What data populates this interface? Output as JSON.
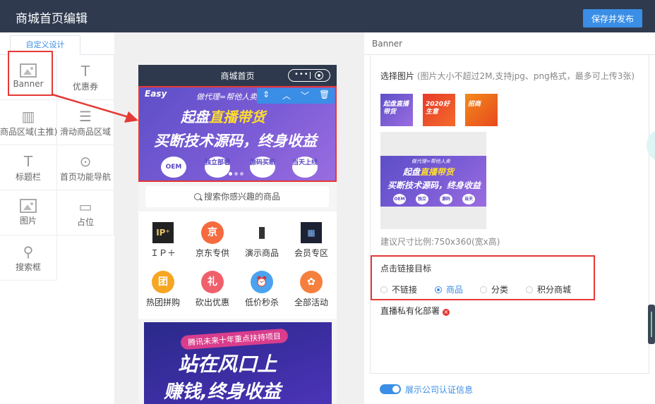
{
  "header": {
    "title": "商城首页编辑",
    "publish_label": "保存并发布"
  },
  "left_panel": {
    "tab_label": "自定义设计",
    "widgets": [
      {
        "label": "Banner",
        "icon": "image-icon"
      },
      {
        "label": "优惠券",
        "icon": "text-t-icon"
      },
      {
        "label": "商品区域(主推)",
        "icon": "building-icon"
      },
      {
        "label": "滑动商品区域",
        "icon": "list-icon"
      },
      {
        "label": "标题栏",
        "icon": "text-t-icon"
      },
      {
        "label": "首页功能导航",
        "icon": "location-pin-icon"
      },
      {
        "label": "图片",
        "icon": "image-icon"
      },
      {
        "label": "占位",
        "icon": "rectangle-icon"
      },
      {
        "label": "搜索框",
        "icon": "search-icon"
      }
    ]
  },
  "phone": {
    "title": "商城首页",
    "capsule_dots": "•••",
    "banner": {
      "logo": "Easy",
      "top_text": "做代理=帮他人卖",
      "line1_white": "起盘",
      "line1_yellow": "直播带货",
      "line2": "买断技术源码，终身收益",
      "pills": [
        "OEM",
        "独立部署",
        "源码买断",
        "当天上线"
      ],
      "toolbar": [
        "⇕",
        "︿",
        "﹀",
        "🗑"
      ]
    },
    "search_placeholder": "搜索你感兴趣的商品",
    "nav_items": [
      {
        "label": "ＩＰ＋",
        "color": "#222222",
        "glyph": "IP⁺"
      },
      {
        "label": "京东专供",
        "color": "#f56a3f",
        "glyph": "京"
      },
      {
        "label": "演示商品",
        "color": "#333333",
        "glyph": "▮"
      },
      {
        "label": "会员专区",
        "color": "#1c2233",
        "glyph": "▦"
      },
      {
        "label": "热团拼购",
        "color": "#f5a623",
        "glyph": "团"
      },
      {
        "label": "砍出优惠",
        "color": "#f0606b",
        "glyph": "礼"
      },
      {
        "label": "低价秒杀",
        "color": "#4aa3f0",
        "glyph": "⏰"
      },
      {
        "label": "全部活动",
        "color": "#f5803e",
        "glyph": "✿"
      }
    ],
    "promo": {
      "tag": "腾讯未来十年重点扶持项目",
      "line1": "站在风口上",
      "line2": "赚钱,终身收益"
    }
  },
  "right_panel": {
    "section_title": "Banner",
    "select_label": "选择图片",
    "select_hint": "(图片大小不超过2M,支持jpg、png格式，最多可上传3张)",
    "thumb_texts": [
      "起盘直播带货",
      "2020好生意",
      "招商"
    ],
    "preview": {
      "top": "做代理=帮他人卖",
      "line1_white": "起盘",
      "line1_yellow": "直播带货",
      "line2": "买断技术源码，终身收益",
      "pills": [
        "OEM",
        "独立",
        "源码",
        "当天"
      ]
    },
    "size_hint": "建议尺寸比例:750x360(宽x高)",
    "link_target": {
      "title": "点击链接目标",
      "options": [
        "不链接",
        "商品",
        "分类",
        "积分商城"
      ],
      "selected": "商品"
    },
    "private_deploy": "直播私有化部署",
    "company_cert_label": "展示公司认证信息"
  }
}
